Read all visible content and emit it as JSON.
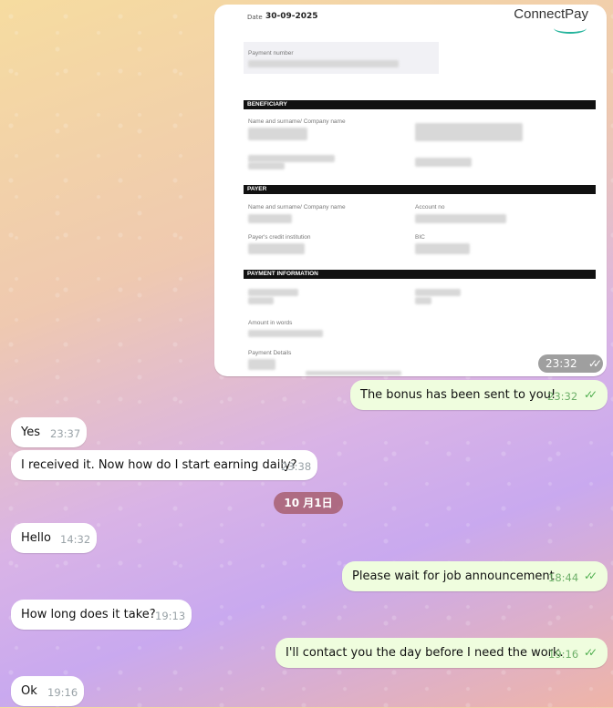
{
  "document": {
    "date_label": "Date",
    "date_value": "30-09-2025",
    "logo_text": "ConnectPay",
    "payment_number_label": "Payment number",
    "sections": {
      "beneficiary": "BENEFICIARY",
      "payer": "PAYER",
      "payment_information": "PAYMENT INFORMATION"
    },
    "fields": {
      "name_surname_company": "Name and surname/ Company name",
      "account_no": "Account no",
      "payers_credit_institution": "Payer's credit institution",
      "bic": "BIC",
      "amount_in_words": "Amount in words",
      "payment_details": "Payment Details"
    },
    "image_time": "23:32"
  },
  "date_separator": "10 月1日",
  "messages": [
    {
      "dir": "out",
      "text": "The bonus has been sent to you!",
      "time": "23:32"
    },
    {
      "dir": "in",
      "text": "Yes",
      "time": "23:37"
    },
    {
      "dir": "in",
      "text": "I received it. Now how do I start earning daily?",
      "time": "23:38"
    },
    {
      "dir": "in",
      "text": "Hello",
      "time": "14:32"
    },
    {
      "dir": "out",
      "text": "Please wait for job announcement",
      "time": "18:44"
    },
    {
      "dir": "in",
      "text": "How long does it take?",
      "time": "19:13"
    },
    {
      "dir": "out",
      "text": "I'll contact you the day before I need the work.",
      "time": "19:16"
    },
    {
      "dir": "in",
      "text": "Ok",
      "time": "19:16"
    }
  ],
  "colors": {
    "incoming_bubble": "#ffffff",
    "outgoing_bubble": "#effdde",
    "read_ticks": "#4fae4e",
    "date_pill": "#a0505a"
  },
  "icons": {
    "read_receipt": "double-check-icon"
  }
}
